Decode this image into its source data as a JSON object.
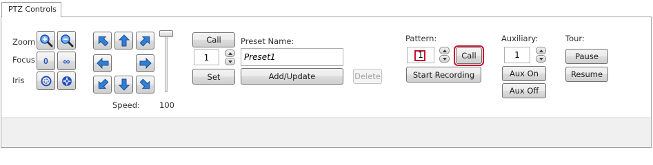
{
  "tab": {
    "label": "PTZ Controls"
  },
  "lens": {
    "zoom_label": "Zoom",
    "focus_label": "Focus",
    "iris_label": "Iris",
    "focus_near_glyph": "0",
    "focus_far_glyph": "∞"
  },
  "speed": {
    "label": "Speed:",
    "value": "100",
    "level": 1.0
  },
  "preset": {
    "call_label": "Call",
    "number": "1",
    "set_label": "Set",
    "name_label": "Preset Name:",
    "name_value": "Preset1",
    "add_update_label": "Add/Update",
    "delete_label": "Delete"
  },
  "pattern": {
    "label": "Pattern:",
    "number": "1",
    "call_label": "Call",
    "start_recording_label": "Start Recording"
  },
  "auxiliary": {
    "label": "Auxiliary:",
    "number": "1",
    "aux_on_label": "Aux On",
    "aux_off_label": "Aux Off"
  },
  "tour": {
    "label": "Tour:",
    "pause_label": "Pause",
    "resume_label": "Resume"
  },
  "colors": {
    "arrow_blue": "#2f7fd6",
    "highlight_red": "#c8102e",
    "icon_blue": "#1f4fbf"
  }
}
